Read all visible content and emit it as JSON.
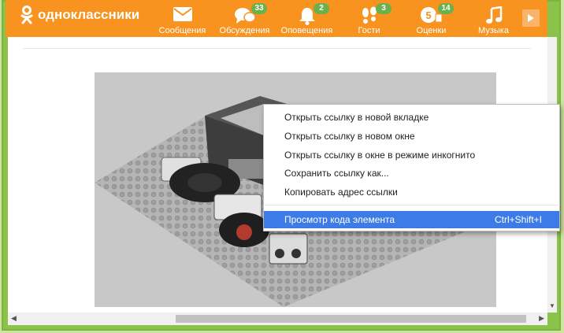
{
  "brand": {
    "name": "одноклассники"
  },
  "nav": [
    {
      "label": "Сообщения",
      "icon": "envelope-icon",
      "badge": ""
    },
    {
      "label": "Обсуждения",
      "icon": "chat-bubbles-icon",
      "badge": "33"
    },
    {
      "label": "Оповещения",
      "icon": "bell-icon",
      "badge": "2"
    },
    {
      "label": "Гости",
      "icon": "footprints-icon",
      "badge": "3"
    },
    {
      "label": "Оценки",
      "icon": "rating-icon",
      "badge": "14"
    },
    {
      "label": "Музыка",
      "icon": "music-note-icon",
      "badge": ""
    }
  ],
  "context_menu": {
    "items": [
      {
        "label": "Открыть ссылку в новой вкладке",
        "shortcut": ""
      },
      {
        "label": "Открыть ссылку в новом окне",
        "shortcut": ""
      },
      {
        "label": "Открыть ссылку в окне в режиме инкогнито",
        "shortcut": ""
      },
      {
        "label": "Сохранить ссылку как...",
        "shortcut": ""
      },
      {
        "label": "Копировать адрес ссылки",
        "shortcut": ""
      },
      {
        "label": "Просмотр кода элемента",
        "shortcut": "Ctrl+Shift+I"
      }
    ]
  },
  "colors": {
    "brand_orange": "#f7931e",
    "badge_green": "#6ab04c",
    "highlight_blue": "#3d7be6"
  }
}
